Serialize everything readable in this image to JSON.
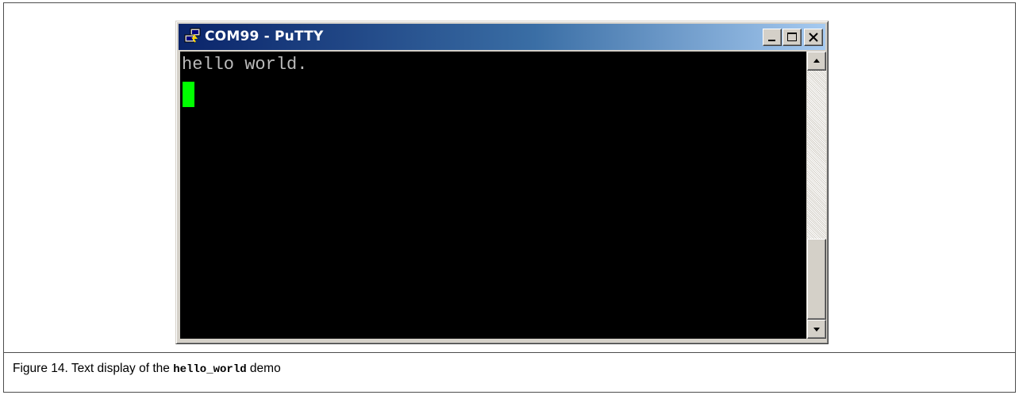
{
  "window": {
    "title": "COM99 - PuTTY",
    "icon": "putty-icon"
  },
  "terminal": {
    "lines": [
      "hello world."
    ],
    "cursor_color": "#00ff00",
    "text_color": "#bbbbbb",
    "background_color": "#000000"
  },
  "title_bar": {
    "buttons": [
      "minimize-icon",
      "maximize-icon",
      "close-icon"
    ]
  },
  "scrollbar": {
    "up_icon": "arrow-up-icon",
    "down_icon": "arrow-down-icon"
  },
  "caption": {
    "prefix": "Figure 14.  Text display of the ",
    "code": "hello_world",
    "suffix": " demo"
  }
}
